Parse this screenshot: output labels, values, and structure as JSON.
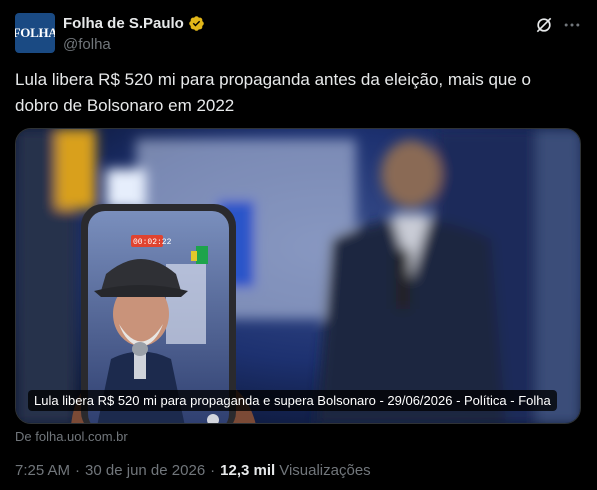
{
  "account": {
    "avatar_text": "FOLHA",
    "name": "Folha de S.Paulo",
    "handle": "@folha",
    "verified_color": "#e2b719"
  },
  "icons": {
    "grok": "grok-icon",
    "more": "more-icon",
    "verified": "verified-badge-icon"
  },
  "tweet": {
    "text": "Lula libera R$ 520 mi para propaganda antes da eleição, mais que o dobro de Bolsonaro em 2022"
  },
  "card": {
    "caption": "Lula libera R$ 520 mi para propaganda e supera Bolsonaro - 29/06/2026 - Política - Folha",
    "phone_recording_time": "00:02:22",
    "source": "De folha.uol.com.br"
  },
  "meta": {
    "time": "7:25 AM",
    "separator": "·",
    "date": "30 de jun de 2026",
    "views_count": "12,3 mil",
    "views_label": "Visualizações"
  },
  "colors": {
    "background": "#000000",
    "text_primary": "#e7e9ea",
    "text_secondary": "#71767b",
    "avatar_bg": "#1a4a83"
  }
}
